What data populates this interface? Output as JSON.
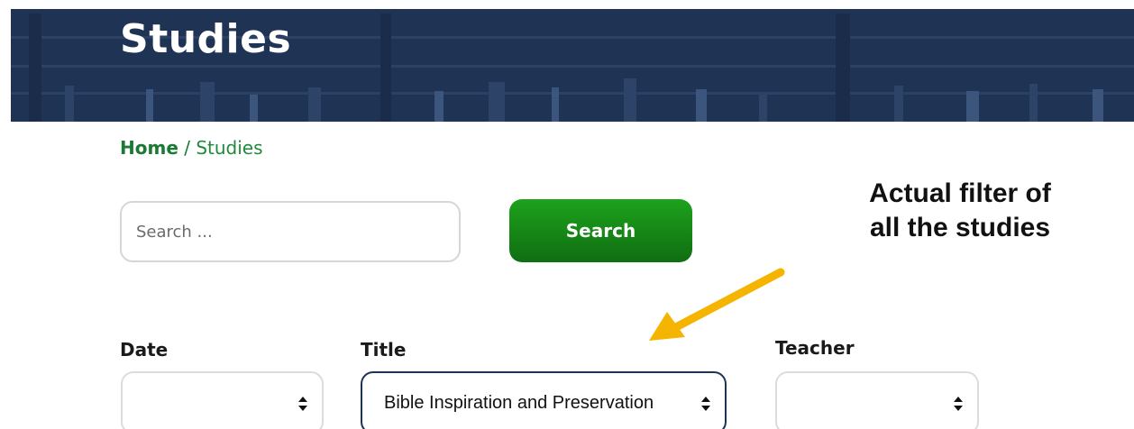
{
  "header": {
    "title": "Studies"
  },
  "breadcrumb": {
    "home": "Home",
    "separator": " / ",
    "current": "Studies"
  },
  "search": {
    "placeholder": "Search ...",
    "value": "",
    "button_label": "Search"
  },
  "annotation": {
    "line1": "Actual filter of",
    "line2": "all the studies",
    "arrow_color": "#f4b400"
  },
  "filters": {
    "date": {
      "label": "Date",
      "value": ""
    },
    "title": {
      "label": "Title",
      "value": "Bible Inspiration and Preservation"
    },
    "teacher": {
      "label": "Teacher",
      "value": ""
    }
  },
  "colors": {
    "hero_bg": "#1f3354",
    "accent_green": "#1a7a34",
    "button_green": "#138a17",
    "arrow": "#f4b400"
  },
  "icons": {
    "select_caret": "up-down-caret-icon",
    "annotation_arrow": "arrow-icon"
  }
}
